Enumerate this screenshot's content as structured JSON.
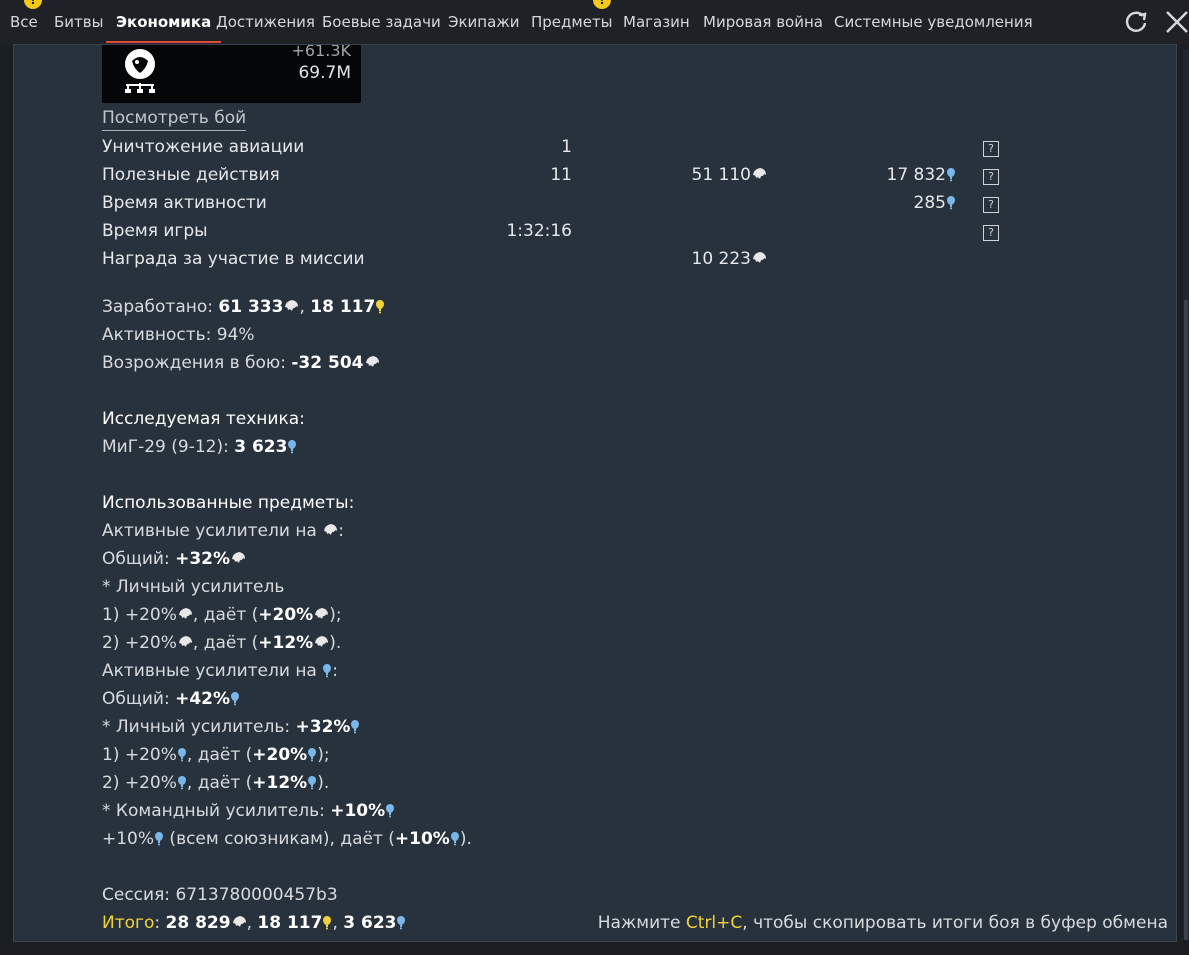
{
  "tabs": [
    {
      "label": "Все",
      "active": false,
      "alert": true
    },
    {
      "label": "Битвы",
      "active": false,
      "alert": false
    },
    {
      "label": "Экономика",
      "active": true,
      "alert": false
    },
    {
      "label": "Достижения",
      "active": false,
      "alert": false
    },
    {
      "label": "Боевые задачи",
      "active": false,
      "alert": false
    },
    {
      "label": "Экипажи",
      "active": false,
      "alert": false
    },
    {
      "label": "Предметы",
      "active": false,
      "alert": true
    },
    {
      "label": "Магазин",
      "active": false,
      "alert": false
    },
    {
      "label": "Мировая война",
      "active": false,
      "alert": false
    },
    {
      "label": "Системные уведомления",
      "active": false,
      "alert": false
    }
  ],
  "alert_glyph": "!",
  "player_card": {
    "top_value": "+61.3K",
    "bottom_value": "69.7M"
  },
  "view_battle_label": "Посмотреть бой",
  "help_glyph": "?",
  "stats_rows": [
    {
      "label": "Уничтожение авиации",
      "count": "1",
      "lions": "",
      "rp": "",
      "help": true
    },
    {
      "label": "Полезные действия",
      "count": "11",
      "lions": "51 110",
      "rp": "17 832",
      "help": true
    },
    {
      "label": "Время активности",
      "count": "",
      "lions": "",
      "rp": "285",
      "help": true
    },
    {
      "label": "Время игры",
      "count": "1:32:16",
      "lions": "",
      "rp": "",
      "help": true
    },
    {
      "label": "Награда за участие в миссии",
      "count": "",
      "lions": "10 223",
      "rp": "",
      "help": false
    }
  ],
  "summary": {
    "earned_label": "Заработано: ",
    "earned_lions": "61 333",
    "earned_sep": ", ",
    "earned_rp": "18 117",
    "activity_label": "Активность: ",
    "activity_value": "94%",
    "respawns_label": "Возрождения в бою: ",
    "respawns_value": "-32 504"
  },
  "research": {
    "heading": "Исследуемая техника:",
    "vehicle_label": "МиГ-29 (9-12): ",
    "vehicle_rp": "3 623"
  },
  "items": {
    "heading": "Использованные предметы:",
    "lion_boosters_label": "Активные усилители на ",
    "colon": ":",
    "total_label": "Общий: ",
    "lion_total": "+32%",
    "personal_label": "* Личный усилитель",
    "lion_b1_pre": "1) +20%",
    "lion_b1_mid": ", даёт (",
    "lion_b1_val": "+20%",
    "lion_b1_end": ");",
    "lion_b2_pre": "2) +20%",
    "lion_b2_mid": ", даёт (",
    "lion_b2_val": "+12%",
    "lion_b2_end": ").",
    "rp_boosters_label": "Активные усилители на ",
    "rp_total": "+42%",
    "rp_personal_label": "* Личный усилитель: ",
    "rp_personal_val": "+32%",
    "rp_b1_pre": "1) +20%",
    "rp_b1_mid": ", даёт (",
    "rp_b1_val": "+20%",
    "rp_b1_end": ");",
    "rp_b2_pre": "2) +20%",
    "rp_b2_mid": ", даёт (",
    "rp_b2_val": "+12%",
    "rp_b2_end": ").",
    "team_label": "* Командный усилитель: ",
    "team_val": "+10%",
    "team_line_pre": "+10%",
    "team_line_mid": " (всем союзникам), даёт (",
    "team_line_val": "+10%",
    "team_line_end": ")."
  },
  "session": {
    "label": "Сессия: ",
    "value": "6713780000457b3"
  },
  "total": {
    "label": "Итого",
    "colon": ": ",
    "lions": "28 829",
    "sep1": ", ",
    "rp_bulb": "18 117",
    "sep2": ", ",
    "rp": "3 623"
  },
  "copy_hint": {
    "pre": "Нажмите ",
    "key": "Ctrl+C",
    "post": ", чтобы скопировать итоги боя в буфер обмена"
  },
  "colors": {
    "accent": "#e04a36",
    "gold": "#f2d23a",
    "rp_blue": "#7ab6ea",
    "panel": "#27323d"
  }
}
